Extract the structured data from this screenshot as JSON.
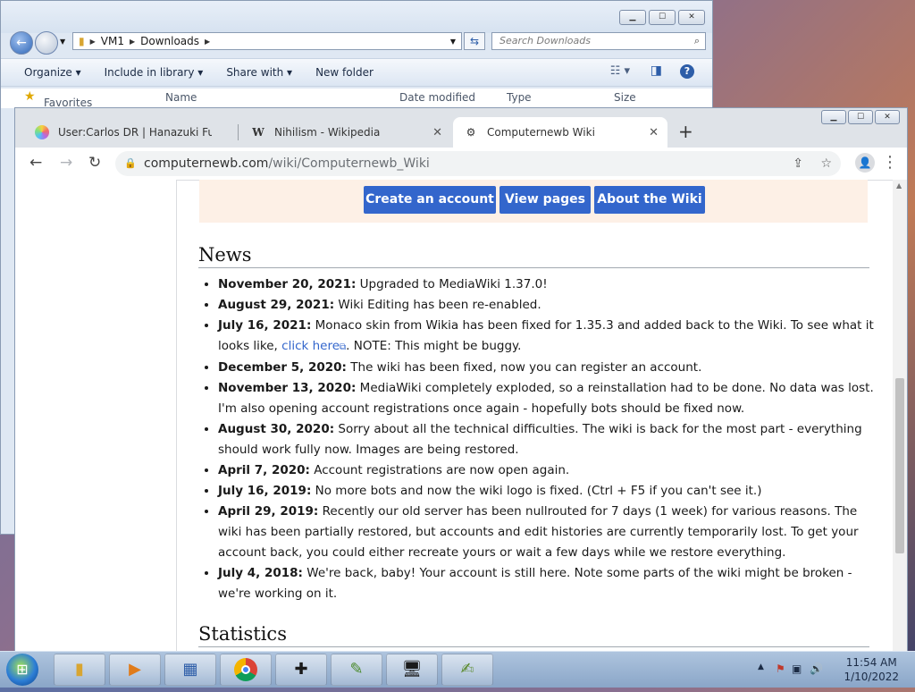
{
  "explorer": {
    "breadcrumb": [
      "VM1",
      "Downloads"
    ],
    "search_placeholder": "Search Downloads",
    "toolbar": [
      "Organize ▾",
      "Include in library ▾",
      "Share with ▾",
      "New folder"
    ],
    "favorites_label": "Favorites",
    "columns": [
      "Name",
      "Date modified",
      "Type",
      "Size"
    ]
  },
  "chrome": {
    "tabs": [
      {
        "title": "User:Carlos DR | Hanazuki Full of",
        "close": "✕"
      },
      {
        "title": "Nihilism - Wikipedia",
        "close": "✕"
      },
      {
        "title": "Computernewb Wiki",
        "close": "✕"
      }
    ],
    "url_host": "computernewb.com",
    "url_path": "/wiki/Computernewb_Wiki"
  },
  "page": {
    "buttons": [
      "Create an account",
      "View pages",
      "About the Wiki"
    ],
    "news_heading": "News",
    "stats_heading": "Statistics",
    "news": [
      {
        "date": "November 20, 2021:",
        "text": "Upgraded to MediaWiki 1.37.0!"
      },
      {
        "date": "August 29, 2021:",
        "text": "Wiki Editing has been re-enabled."
      },
      {
        "date": "July 16, 2021:",
        "text": "Monaco skin from Wikia has been fixed for 1.35.3 and added back to the Wiki. To see what it looks like, ",
        "link": "click here",
        "after": ". NOTE: This might be buggy."
      },
      {
        "date": "December 5, 2020:",
        "text": "The wiki has been fixed, now you can register an account."
      },
      {
        "date": "November 13, 2020:",
        "text": "MediaWiki completely exploded, so a reinstallation had to be done. No data was lost. I'm also opening account registrations once again - hopefully bots should be fixed now."
      },
      {
        "date": "August 30, 2020:",
        "text": "Sorry about all the technical difficulties. The wiki is back for the most part - everything should work fully now. Images are being restored."
      },
      {
        "date": "April 7, 2020:",
        "text": "Account registrations are now open again."
      },
      {
        "date": "July 16, 2019:",
        "text": "No more bots and now the wiki logo is fixed. (Ctrl + F5 if you can't see it.)"
      },
      {
        "date": "April 29, 2019:",
        "text": "Recently our old server has been nullrouted for 7 days (1 week) for various reasons. The wiki has been partially restored, but accounts and edit histories are currently temporarily lost. To get your account back, you could either recreate yours or wait a few days while we restore everything."
      },
      {
        "date": "July 4, 2018:",
        "text": "We're back, baby! Your account is still here. Note some parts of the wiki might be broken - we're working on it."
      }
    ]
  },
  "taskbar": {
    "time": "11:54 AM",
    "date": "1/10/2022"
  },
  "colors": {
    "wiki_button": "#3366cc",
    "cta_background": "#fdf0e6"
  }
}
